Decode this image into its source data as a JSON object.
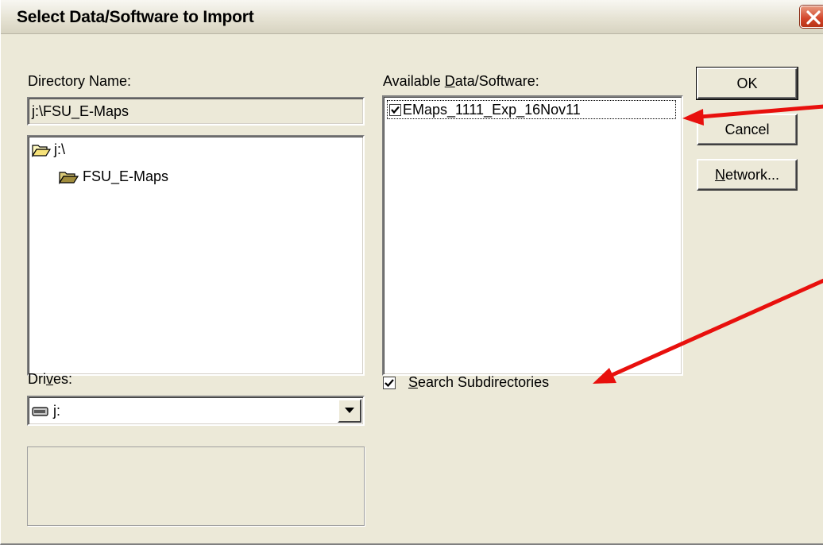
{
  "window": {
    "title": "Select Data/Software to Import"
  },
  "directory": {
    "label": "Directory Name:",
    "value": "j:\\FSU_E-Maps",
    "tree": [
      {
        "label": "j:\\",
        "icon": "open-folder-icon"
      },
      {
        "label": "FSU_E-Maps",
        "icon": "open-folder-icon"
      }
    ]
  },
  "available": {
    "label_pre": "Available ",
    "label_underlined": "D",
    "label_post": "ata/Software:",
    "items": [
      {
        "label": "EMaps_1111_Exp_16Nov11",
        "checked": true
      }
    ]
  },
  "buttons": {
    "ok": "OK",
    "cancel": "Cancel",
    "network_underlined": "N",
    "network_rest": "etwork..."
  },
  "drives": {
    "label_pre": "Dri",
    "label_underlined": "v",
    "label_post": "es:",
    "selected": "j:",
    "icon": "drive-icon"
  },
  "search_subdirs": {
    "label_underlined": "S",
    "label_rest": "earch Subdirectories",
    "checked": true
  },
  "annotations": {
    "arrow_color": "#e8100d"
  }
}
